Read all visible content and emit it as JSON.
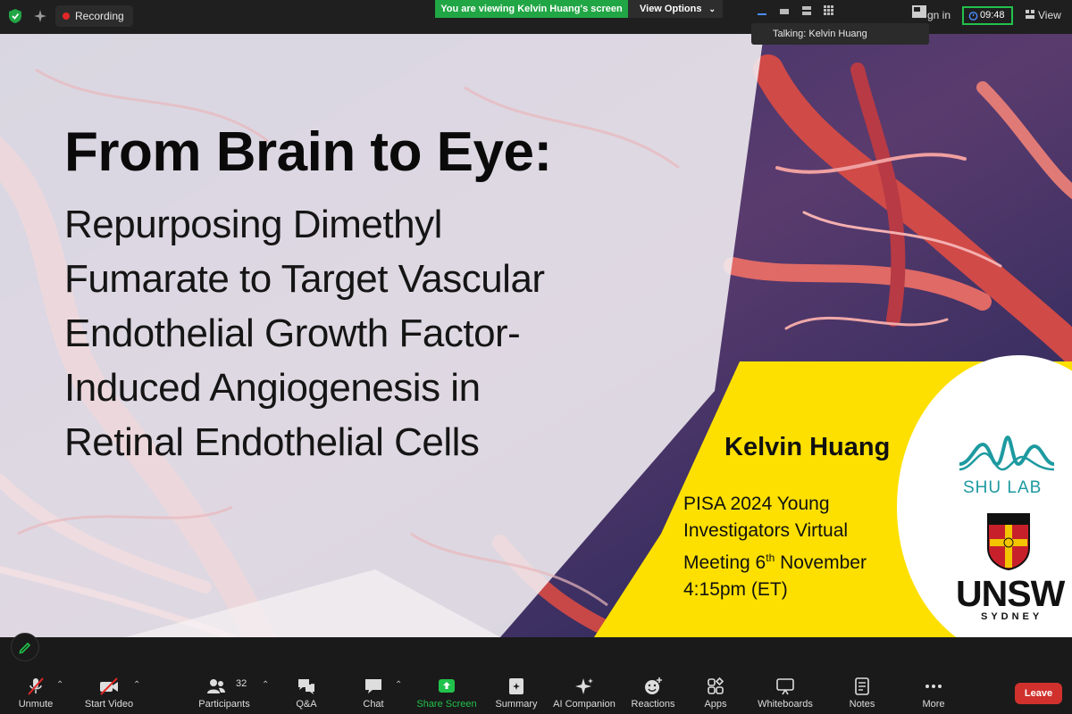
{
  "topbar": {
    "recording_label": "Recording",
    "viewing_banner": "You are viewing Kelvin Huang's screen",
    "view_options_label": "View Options",
    "talking_label": "Talking: Kelvin Huang",
    "signin_label": "gn in",
    "timer": "09:48",
    "view_label": "View"
  },
  "slide": {
    "title": "From Brain to Eye:",
    "subtitle_lines": [
      "Repurposing Dimethyl",
      "Fumarate to Target Vascular",
      "Endothelial Growth Factor-",
      "Induced Angiogenesis in",
      "Retinal Endothelial Cells"
    ],
    "presenter": "Kelvin Huang",
    "meeting_line1": "PISA 2024 Young",
    "meeting_line2": "Investigators Virtual",
    "meeting_line3_pre": "Meeting 6",
    "meeting_line3_sup": "th",
    "meeting_line3_post": " November",
    "meeting_line4": "4:15pm (ET)",
    "shulab": "SHU LAB",
    "unsw": "UNSW",
    "sydney": "SYDNEY"
  },
  "toolbar": {
    "unmute": "Unmute",
    "start_video": "Start Video",
    "participants": "Participants",
    "participants_count": "32",
    "qa": "Q&A",
    "chat": "Chat",
    "share_screen": "Share Screen",
    "summary": "Summary",
    "ai_companion": "AI Companion",
    "reactions": "Reactions",
    "apps": "Apps",
    "whiteboards": "Whiteboards",
    "notes": "Notes",
    "more": "More",
    "leave": "Leave"
  },
  "colors": {
    "share_green": "#21a645",
    "slide_yellow": "#fde000",
    "leave_red": "#d0312d",
    "timer_green": "#21c24b"
  }
}
